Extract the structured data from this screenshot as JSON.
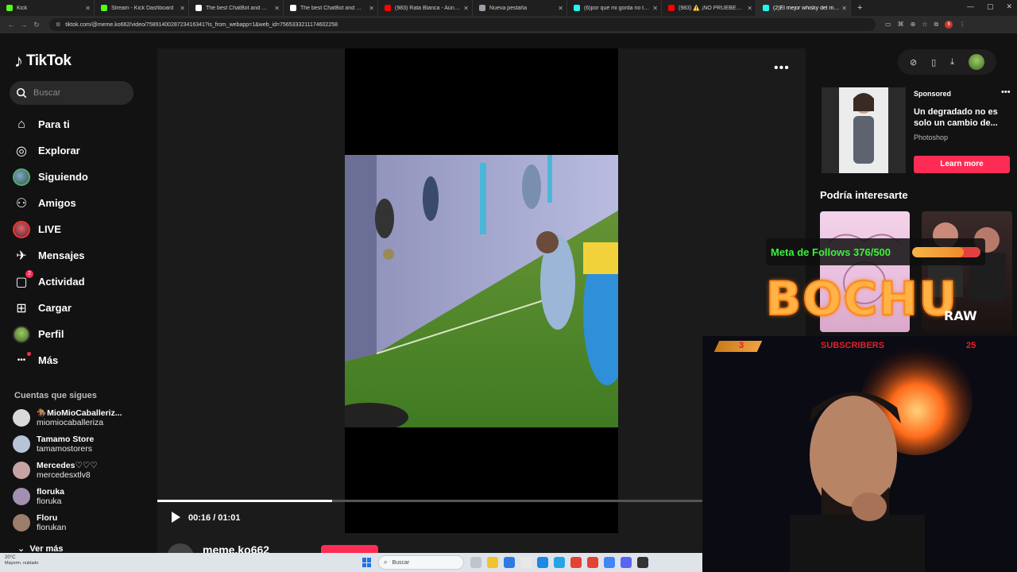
{
  "browser": {
    "tabs": [
      {
        "label": "Kick",
        "color": "#53fc18",
        "active": false
      },
      {
        "label": "Stream - Kick Dashboard",
        "color": "#53fc18",
        "active": false
      },
      {
        "label": "The best ChatBot and Widg",
        "color": "#ffffff",
        "active": false
      },
      {
        "label": "The best ChatBot and Widgets",
        "color": "#ffffff",
        "active": false
      },
      {
        "label": "(983) Rata Blanca - Aún estás e",
        "color": "#ff0000",
        "active": false
      },
      {
        "label": "Nueva pestaña",
        "color": "#9aa0a6",
        "active": false
      },
      {
        "label": "(6)por qué mi gorda no tiene p",
        "color": "#25f4ee",
        "active": false
      },
      {
        "label": "(983) ⚠️ ¡NO PRUEBES LA BEB",
        "color": "#ff0000",
        "active": false
      },
      {
        "label": "(2)El mejor whisky del mundo",
        "color": "#25f4ee",
        "active": true
      }
    ],
    "url": "tiktok.com/@meme.ko662/video/7589140028723416341?is_from_webapp=1&web_id=7565333211174602258",
    "extension_badge": "8"
  },
  "tiktok": {
    "logo": "TikTok",
    "search_placeholder": "Buscar",
    "nav": [
      {
        "label": "Para ti",
        "icon": "home-icon"
      },
      {
        "label": "Explorar",
        "icon": "compass-icon"
      },
      {
        "label": "Siguiendo",
        "icon": "following-avatar-icon"
      },
      {
        "label": "Amigos",
        "icon": "friends-icon"
      },
      {
        "label": "LIVE",
        "icon": "live-avatar-icon"
      },
      {
        "label": "Mensajes",
        "icon": "messages-icon"
      },
      {
        "label": "Actividad",
        "icon": "activity-icon",
        "badge": "2"
      },
      {
        "label": "Cargar",
        "icon": "upload-icon"
      },
      {
        "label": "Perfil",
        "icon": "profile-avatar-icon"
      },
      {
        "label": "Más",
        "icon": "more-icon"
      }
    ],
    "following_title": "Cuentas que sigues",
    "following": [
      {
        "name": "🏇MioMioCaballeriz...",
        "user": "miomiocaballeriza"
      },
      {
        "name": "Tamamo Store",
        "user": "tamamostorers"
      },
      {
        "name": "Mercedes♡♡♡",
        "user": "mercedesxtlv8"
      },
      {
        "name": "floruka",
        "user": "floruka"
      },
      {
        "name": "Floru",
        "user": "florukan"
      }
    ],
    "see_more": "Ver más",
    "video": {
      "current_time": "00:16",
      "duration": "01:01",
      "time_label": "00:16 / 01:01",
      "progress": 0.32,
      "author": "meme.ko662"
    },
    "ad": {
      "sponsored": "Sponsored",
      "title": "Un degradado no es solo un cambio de...",
      "source": "Photoshop",
      "cta": "Learn more"
    },
    "recommend_title": "Podría interesarte"
  },
  "stream_overlay": {
    "goal_text": "Meta de Follows 376/500",
    "goal_progress": 0.752,
    "brand": "BOCHU",
    "brand_sub": "RAW",
    "subscribers_label": "SUBSCRIBERS",
    "subscribers_count": "3",
    "subscribers_goal": "25"
  },
  "taskbar": {
    "weather_temp": "20°C",
    "weather_desc": "Mayorm. nublado",
    "search_placeholder": "Buscar"
  },
  "colors": {
    "accent": "#fe2c55",
    "goal_text": "#3ef03e",
    "subs_red": "#e0202a"
  }
}
